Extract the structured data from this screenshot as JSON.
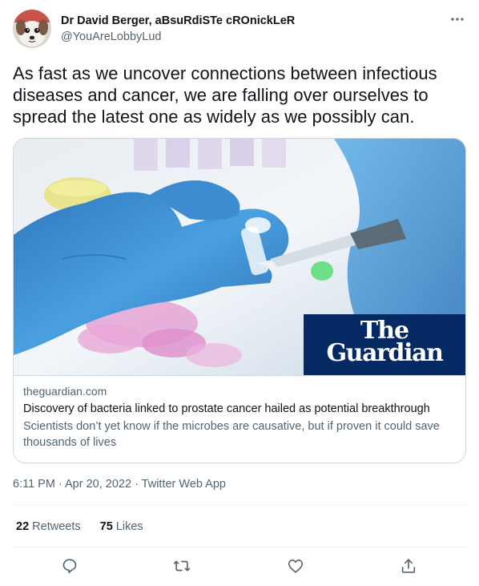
{
  "author": {
    "display_name": "Dr David Berger, aBsuRdiSTe cROnickLeR",
    "handle": "@YouAreLobbyLud",
    "avatar_icon": "dog-avatar"
  },
  "tweet": {
    "text": "As fast as we uncover connections between infectious diseases and cancer, we are falling over ourselves to spread the latest one as widely as we possibly can."
  },
  "card": {
    "logo_line1": "The",
    "logo_line2": "Guardian",
    "domain": "theguardian.com",
    "title": "Discovery of bacteria linked to prostate cancer hailed as potential breakthrough",
    "description": "Scientists don’t yet know if the microbes are causative, but if proven it could save thousands of lives"
  },
  "meta": {
    "text": "6:11 PM · Apr 20, 2022 · Twitter Web App"
  },
  "stats": {
    "retweets_count": "22",
    "retweets_label": "Retweets",
    "likes_count": "75",
    "likes_label": "Likes"
  },
  "actions": {
    "reply_icon": "reply-icon",
    "retweet_icon": "retweet-icon",
    "like_icon": "heart-icon",
    "share_icon": "share-icon"
  },
  "colors": {
    "text_primary": "#0f1419",
    "text_secondary": "#536471",
    "border": "#cfd9de",
    "guardian_blue": "#052962",
    "glove_blue": "#3a8fd6"
  }
}
